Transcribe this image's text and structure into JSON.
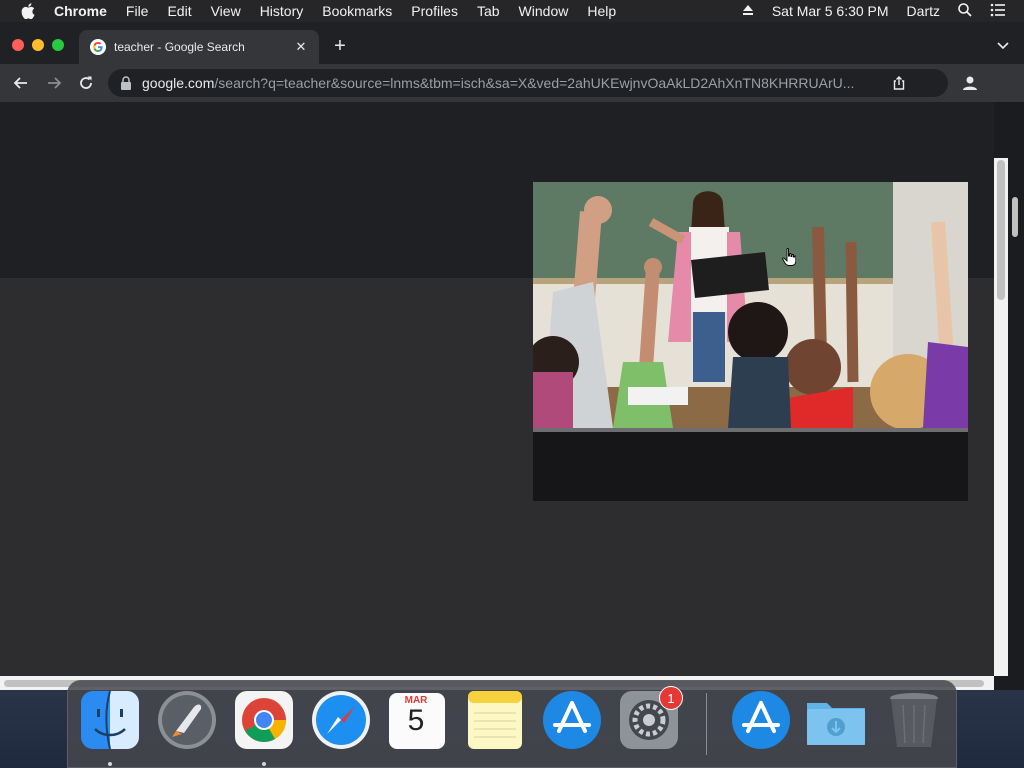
{
  "menubar": {
    "app_name": "Chrome",
    "items": [
      "File",
      "Edit",
      "View",
      "History",
      "Bookmarks",
      "Profiles",
      "Tab",
      "Window",
      "Help"
    ],
    "clock": "Sat Mar 5  6:30 PM",
    "user": "Dartz"
  },
  "browser": {
    "tab_title": "teacher - Google Search",
    "new_tab_symbol": "+",
    "close_symbol": "✕",
    "url_host": "google.com",
    "url_path": "/search?q=teacher&source=lnms&tbm=isch&sa=X&ved=2ahUKEwjnvOaAkLD2AhXnTN8KHRRUArU..."
  },
  "dock": {
    "items": [
      {
        "name": "Finder",
        "icon": "finder-icon",
        "running": true
      },
      {
        "name": "Launchpad",
        "icon": "launchpad-icon",
        "running": false
      },
      {
        "name": "Google Chrome",
        "icon": "chrome-icon",
        "running": true
      },
      {
        "name": "Safari",
        "icon": "safari-icon",
        "running": false
      },
      {
        "name": "Calendar",
        "icon": "calendar-icon",
        "running": false,
        "month": "MAR",
        "day": "5"
      },
      {
        "name": "Notes",
        "icon": "notes-icon",
        "running": false
      },
      {
        "name": "App Store",
        "icon": "app-store-icon",
        "running": false
      },
      {
        "name": "System Preferences",
        "icon": "system-preferences-icon",
        "running": false,
        "badge": "1"
      },
      {
        "name": "App Store Download",
        "icon": "app-store-icon",
        "running": false
      },
      {
        "name": "Downloads",
        "icon": "downloads-folder-icon",
        "running": false
      },
      {
        "name": "Trash",
        "icon": "trash-icon",
        "running": false
      }
    ]
  },
  "colors": {
    "menubar_bg": "#262628",
    "tabstrip_bg": "#202124",
    "toolbar_bg": "#35363a",
    "page_bg": "#2d2d2f",
    "badge_red": "#e53935"
  }
}
